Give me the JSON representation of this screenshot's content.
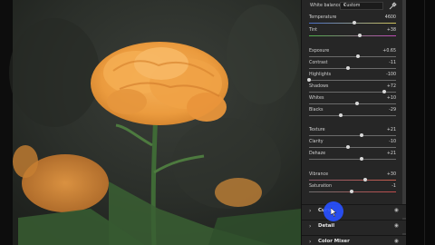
{
  "white_balance": {
    "label": "White balance",
    "value": "Custom"
  },
  "sliders": [
    {
      "name": "temperature",
      "label": "Temperature",
      "value": "4600",
      "level": 0.52
    },
    {
      "name": "tint",
      "label": "Tint",
      "value": "+38",
      "level": 0.58
    },
    {
      "name": "exposure",
      "label": "Exposure",
      "value": "+0.65",
      "level": 0.56
    },
    {
      "name": "contrast",
      "label": "Contrast",
      "value": "-11",
      "level": 0.45
    },
    {
      "name": "highlights",
      "label": "Highlights",
      "value": "-100",
      "level": 0.0
    },
    {
      "name": "shadows",
      "label": "Shadows",
      "value": "+72",
      "level": 0.86
    },
    {
      "name": "whites",
      "label": "Whites",
      "value": "+10",
      "level": 0.55
    },
    {
      "name": "blacks",
      "label": "Blacks",
      "value": "-29",
      "level": 0.36
    },
    {
      "name": "texture",
      "label": "Texture",
      "value": "+21",
      "level": 0.6
    },
    {
      "name": "clarity",
      "label": "Clarity",
      "value": "-10",
      "level": 0.45
    },
    {
      "name": "dehaze",
      "label": "Dehaze",
      "value": "+21",
      "level": 0.6
    },
    {
      "name": "vibrance",
      "label": "Vibrance",
      "value": "+30",
      "level": 0.65
    },
    {
      "name": "saturation",
      "label": "Saturation",
      "value": "-1",
      "level": 0.49
    }
  ],
  "sections": [
    {
      "name": "curve",
      "title": "Curve"
    },
    {
      "name": "detail",
      "title": "Detail"
    },
    {
      "name": "color-mixer",
      "title": "Color Mixer"
    }
  ],
  "colors": {
    "panel_bg": "#262626",
    "cursor": "#2850ff",
    "flower": "#f2a54a"
  }
}
